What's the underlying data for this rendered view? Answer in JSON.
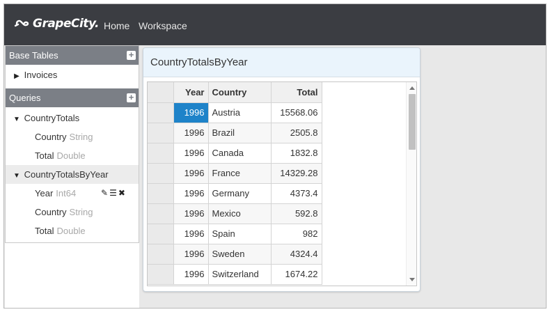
{
  "navbar": {
    "brand": "GrapeCity.",
    "links": [
      "Home",
      "Workspace"
    ]
  },
  "sidebar": {
    "base_tables": {
      "title": "Base Tables",
      "items": [
        "Invoices"
      ]
    },
    "queries": {
      "title": "Queries",
      "items": [
        {
          "name": "CountryTotals",
          "fields": [
            {
              "name": "Country",
              "type": "String"
            },
            {
              "name": "Total",
              "type": "Double"
            }
          ]
        },
        {
          "name": "CountryTotalsByYear",
          "fields": [
            {
              "name": "Year",
              "type": "Int64"
            },
            {
              "name": "Country",
              "type": "String"
            },
            {
              "name": "Total",
              "type": "Double"
            }
          ]
        }
      ]
    }
  },
  "panel": {
    "title": "CountryTotalsByYear",
    "grid": {
      "columns": [
        "Year",
        "Country",
        "Total"
      ],
      "rows": [
        [
          "1996",
          "Austria",
          "15568.06"
        ],
        [
          "1996",
          "Brazil",
          "2505.8"
        ],
        [
          "1996",
          "Canada",
          "1832.8"
        ],
        [
          "1996",
          "France",
          "14329.28"
        ],
        [
          "1996",
          "Germany",
          "4373.4"
        ],
        [
          "1996",
          "Mexico",
          "592.8"
        ],
        [
          "1996",
          "Spain",
          "982"
        ],
        [
          "1996",
          "Sweden",
          "4324.4"
        ],
        [
          "1996",
          "Switzerland",
          "1674.22"
        ]
      ]
    }
  },
  "icons": {
    "plus": "+",
    "caret_right": "▶",
    "caret_down": "▼",
    "edit": "✎",
    "list": "☰",
    "delete": "✖"
  },
  "colors": {
    "navbar": "#3b3d42",
    "section_header": "#7b7f86",
    "panel_header": "#eaf4fc",
    "selection": "#1e83c9"
  }
}
